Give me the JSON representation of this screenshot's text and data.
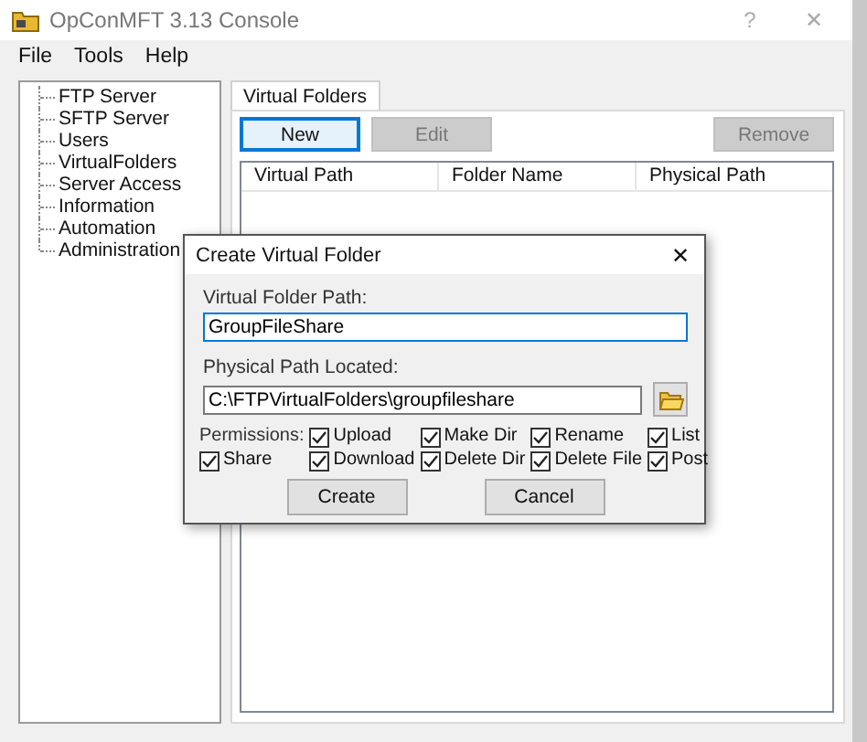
{
  "window": {
    "title": "OpConMFT 3.13 Console",
    "help_glyph": "?",
    "close_glyph": "✕"
  },
  "menu": [
    "File",
    "Tools",
    "Help"
  ],
  "tree": {
    "items": [
      {
        "label": "FTP Server",
        "selected": false
      },
      {
        "label": "SFTP Server",
        "selected": false
      },
      {
        "label": "Users",
        "selected": false
      },
      {
        "label": "VirtualFolders",
        "selected": false
      },
      {
        "label": "Server Access",
        "selected": false
      },
      {
        "label": "Information",
        "selected": false
      },
      {
        "label": "Automation",
        "selected": false
      },
      {
        "label": "Administration",
        "selected": false
      }
    ]
  },
  "tabs": [
    {
      "label": "Virtual Folders",
      "selected": true
    }
  ],
  "toolbar": [
    {
      "label": "New",
      "disabled": false,
      "focused": true
    },
    {
      "label": "Edit",
      "disabled": true,
      "focused": false
    },
    {
      "label": "Remove",
      "disabled": true,
      "focused": false
    }
  ],
  "table": {
    "columns": [
      "Virtual Path",
      "Folder Name",
      "Physical Path"
    ]
  },
  "dialog": {
    "title": "Create Virtual Folder",
    "close_glyph": "✕",
    "virtual_path": {
      "label": "Virtual Folder Path:",
      "value": "GroupFileShare"
    },
    "physical_path": {
      "label": "Physical Path Located:",
      "value": "C:\\FTPVirtualFolders\\groupfileshare"
    },
    "permissions_label": "Permissions:",
    "permissions": [
      {
        "label": "Upload",
        "checked": true
      },
      {
        "label": "Make Dir",
        "checked": true
      },
      {
        "label": "Rename",
        "checked": true
      },
      {
        "label": "List",
        "checked": true
      },
      {
        "label": "Share",
        "checked": true
      },
      {
        "label": "Download",
        "checked": true
      },
      {
        "label": "Delete Dir",
        "checked": true
      },
      {
        "label": "Delete File",
        "checked": true
      },
      {
        "label": "Post",
        "checked": true
      }
    ],
    "buttons": [
      "Create",
      "Cancel"
    ]
  }
}
